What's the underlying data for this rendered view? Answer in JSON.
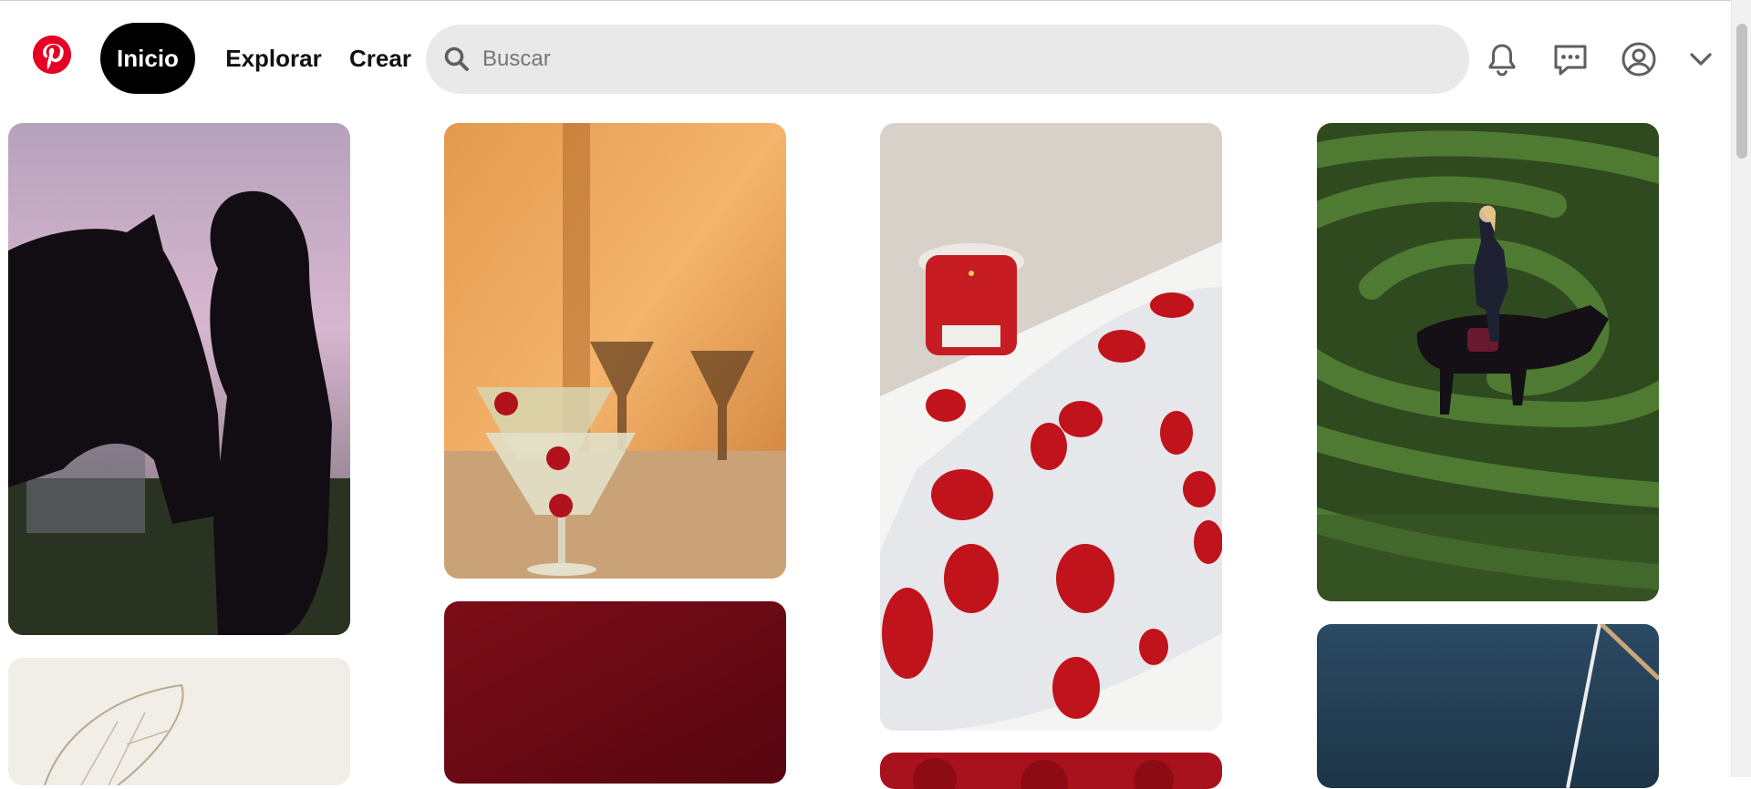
{
  "header": {
    "logo_alt": "Pinterest",
    "nav": {
      "home": "Inicio",
      "explore": "Explorar",
      "create": "Crear"
    },
    "search": {
      "placeholder": "Buscar",
      "value": ""
    },
    "icons": [
      "pinterest-logo-icon",
      "search-icon",
      "bell-icon",
      "messages-icon",
      "user-profile-icon",
      "chevron-down-icon"
    ]
  },
  "colors": {
    "brand": "#e60023",
    "active_nav_bg": "#000000",
    "search_bg": "#e9e9e9"
  },
  "feed": {
    "pins": [
      {
        "name": "pin-horse-silhouette",
        "description": "silhouette of a woman and a horse at dusk"
      },
      {
        "name": "pin-cherry-cocktails",
        "description": "martini glasses with cherries and shadows"
      },
      {
        "name": "pin-candle-rose-bath",
        "description": "red candle and rose petals on bath foam"
      },
      {
        "name": "pin-rider-hedge-maze",
        "description": "rider on a black horse in a hedge maze"
      },
      {
        "name": "pin-wing-sketch",
        "description": "wing sketch on white"
      },
      {
        "name": "pin-dark-red-texture",
        "description": "dark red textured fabric"
      },
      {
        "name": "pin-red-roses",
        "description": "red roses"
      },
      {
        "name": "pin-sea-sailing",
        "description": "dark blue sea water"
      }
    ]
  }
}
